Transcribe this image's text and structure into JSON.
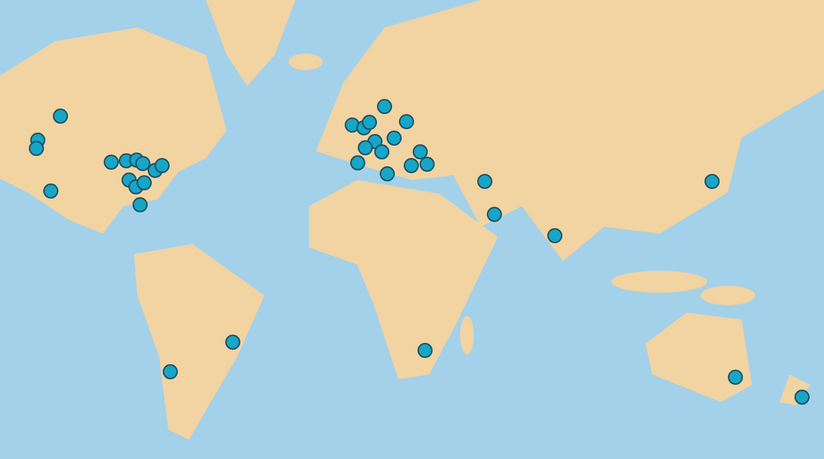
{
  "map": {
    "kind": "picture",
    "markers": [
      {
        "kind": "pin"
      },
      {
        "kind": "pin"
      },
      {
        "kind": "pin"
      },
      {
        "kind": "pin"
      },
      {
        "kind": "pin"
      },
      {
        "kind": "pin"
      },
      {
        "kind": "pin"
      },
      {
        "kind": "pin"
      },
      {
        "kind": "pin"
      },
      {
        "kind": "pin"
      },
      {
        "kind": "pin"
      },
      {
        "kind": "pin"
      },
      {
        "kind": "pin"
      },
      {
        "kind": "pin"
      },
      {
        "kind": "pin"
      },
      {
        "kind": "pin"
      },
      {
        "kind": "pin"
      },
      {
        "kind": "pin"
      },
      {
        "kind": "pin"
      },
      {
        "kind": "pin"
      },
      {
        "kind": "pin"
      },
      {
        "kind": "pin"
      },
      {
        "kind": "pin"
      },
      {
        "kind": "pin"
      },
      {
        "kind": "pin"
      },
      {
        "kind": "pin"
      },
      {
        "kind": "pin"
      },
      {
        "kind": "pin"
      },
      {
        "kind": "pin"
      },
      {
        "kind": "pin"
      },
      {
        "kind": "pin"
      },
      {
        "kind": "pin"
      },
      {
        "kind": "pin"
      },
      {
        "kind": "pin"
      },
      {
        "kind": "pin"
      },
      {
        "kind": "pin"
      },
      {
        "kind": "pin"
      }
    ]
  }
}
